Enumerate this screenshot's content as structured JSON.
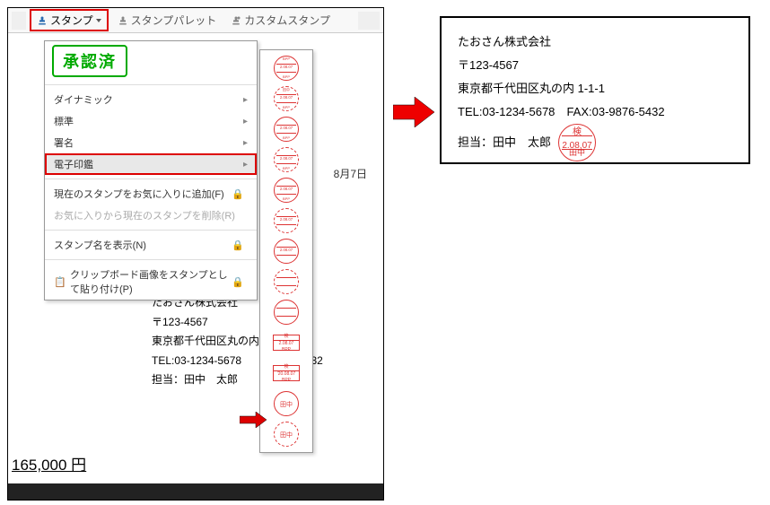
{
  "toolbar": {
    "stamp_label": "スタンプ",
    "palette_label": "スタンプパレット",
    "custom_label": "カスタムスタンプ"
  },
  "dropdown": {
    "approved": "承認済",
    "items": [
      {
        "label": "ダイナミック",
        "has_sub": true
      },
      {
        "label": "標準",
        "has_sub": true
      },
      {
        "label": "署名",
        "has_sub": true
      },
      {
        "label": "電子印鑑",
        "has_sub": true,
        "highlighted": true
      }
    ],
    "fav_add": "現在のスタンプをお気に入りに追加(F)",
    "fav_remove": "お気に入りから現在のスタンプを削除(R)",
    "show_names": "スタンプ名を表示(N)",
    "clipboard": "クリップボード画像をスタンプとして貼り付け(P)"
  },
  "stamps": {
    "date1": "2.08.07",
    "date2": "'20.08.07",
    "top": "検",
    "bottom": "田中",
    "bpp": "BPP"
  },
  "doc": {
    "date_text": "8月7日",
    "company": "たおさん株式会社",
    "postal": "〒123-4567",
    "address": "東京都千代田区丸の内",
    "address_suffix": " 1-1-1",
    "tel": "TEL:03-1234-5678",
    "fax": "FAX:03-9876-5432",
    "fax_tail": "76-5432",
    "person": "担当：田中　太郎",
    "total": "165,000 円"
  },
  "icons": {
    "stamp": "stamp",
    "palette": "palette",
    "custom": "custom"
  }
}
